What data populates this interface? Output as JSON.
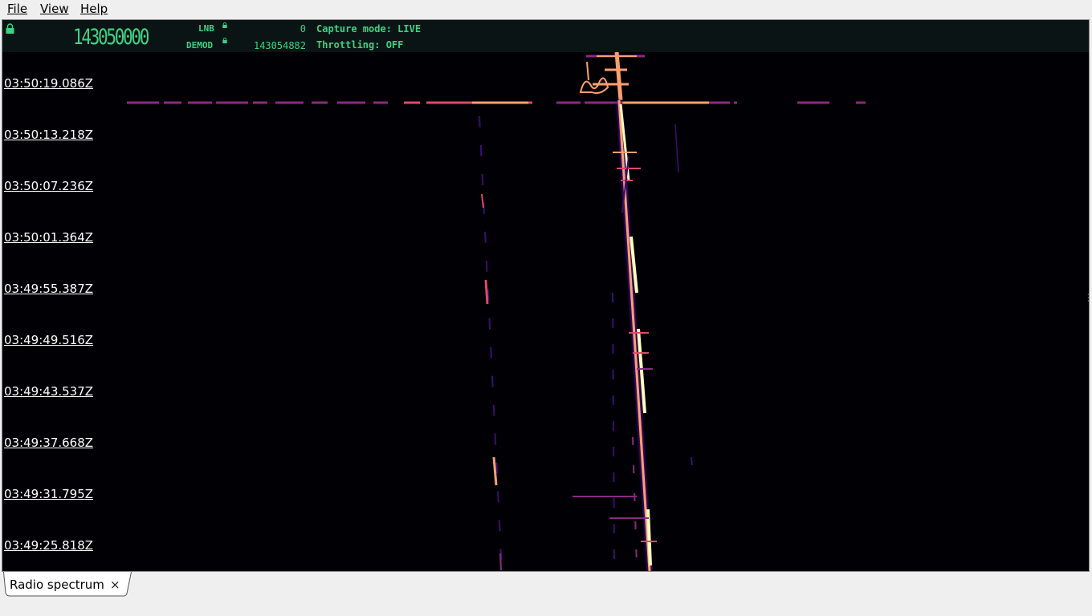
{
  "menu": {
    "file": "File",
    "view": "View",
    "help": "Help"
  },
  "header": {
    "frequency": "143050000",
    "lnb_label": "LNB",
    "lnb_value": "0",
    "demod_label": "DEMOD",
    "demod_value": "143054882",
    "capture_mode": "Capture mode: LIVE",
    "throttling": "Throttling: OFF",
    "accent_color": "#3fd184"
  },
  "waterfall": {
    "timestamps": [
      "03:50:19.086Z",
      "03:50:13.218Z",
      "03:50:07.236Z",
      "03:50:01.364Z",
      "03:49:55.387Z",
      "03:49:49.516Z",
      "03:49:43.537Z",
      "03:49:37.668Z",
      "03:49:31.795Z",
      "03:49:25.818Z"
    ],
    "colormap": [
      "#000005",
      "#3b0f70",
      "#8c2981",
      "#de4968",
      "#fe9f6d",
      "#fcfdbf"
    ]
  },
  "tabs": [
    {
      "label": "Radio spectrum",
      "close": "×"
    }
  ]
}
